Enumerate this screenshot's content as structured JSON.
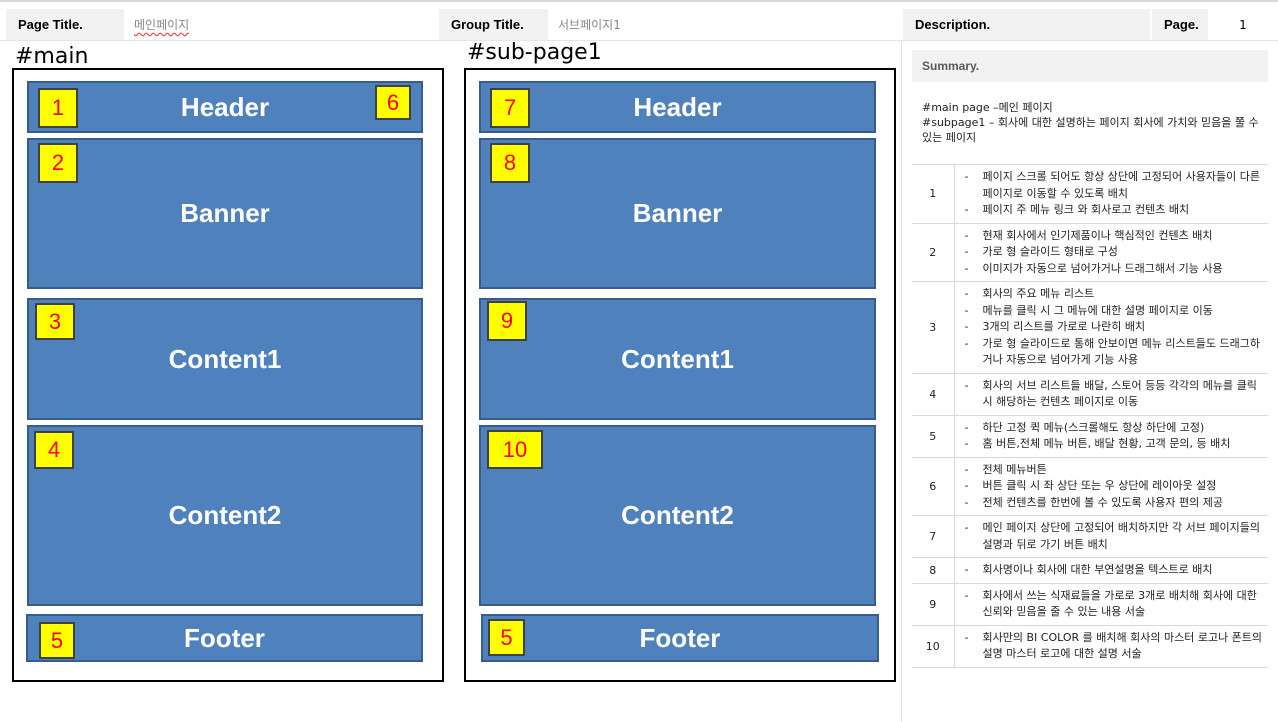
{
  "header": {
    "page_title_label": "Page Title.",
    "page_title_value": "메인페이지",
    "group_title_label": "Group Title.",
    "group_title_value": "서브페이지1",
    "description_label": "Description.",
    "page_label": "Page.",
    "page_value": "1"
  },
  "main_frame": {
    "title": "#main",
    "blocks": {
      "header": "Header",
      "banner": "Banner",
      "content1": "Content1",
      "content2": "Content2",
      "footer": "Footer"
    },
    "badges": [
      "1",
      "6",
      "2",
      "3",
      "4",
      "5"
    ]
  },
  "sub_frame": {
    "title": "#sub-page1",
    "blocks": {
      "header": "Header",
      "banner": "Banner",
      "content1": "Content1",
      "content2": "Content2",
      "footer": "Footer"
    },
    "badges": [
      "7",
      "8",
      "9",
      "10",
      "5"
    ]
  },
  "description": {
    "summary_label": "Summary.",
    "summary_lines": [
      "#main page –메인 페이지",
      "#subpage1 – 회사에 대한 설명하는 페이지 회사에 가치와 믿음을 쭐 수 있는 페이지"
    ],
    "rows": [
      {
        "num": "1",
        "items": [
          "페이지 스크롤 되어도 항상 상단에 고정되어 사용자들이 다른 페이지로 이동할 수 있도록 배치",
          "페이지 주 메뉴 링크 와 회사로고 컨텐츠 배치"
        ]
      },
      {
        "num": "2",
        "items": [
          "현재 회사에서 인기제품이나 핵심적인 컨텐츠 배치",
          "가로 형 슬라이드 형태로 구성",
          "이미지가 자동으로 넘어가거나 드래그해서 기능 사용"
        ]
      },
      {
        "num": "3",
        "items": [
          "회사의 주요 메뉴 리스트",
          "메뉴를 클릭 시 그 메뉴에 대한 설명 페이지로 이동",
          "3개의 리스트를 가로로 나란히 배치",
          "가로 형 슬라이드로 통해 안보이면 메뉴 리스트들도 드래그하거나 자동으로 넘어가게 기능 사용"
        ]
      },
      {
        "num": "4",
        "items": [
          "회사의 서브 리스트들 배달, 스토어 등등 각각의 메뉴를 클릭 시 해당하는 컨텐츠 페이지로 이동"
        ]
      },
      {
        "num": "5",
        "items": [
          "하단 고정 퀵 메뉴(스크롤해도 항상 하단에 고정)",
          "홈 버튼,전체 메뉴 버튼, 배달 현황, 고객 문의, 등 배치"
        ]
      },
      {
        "num": "6",
        "items": [
          "전체 메뉴버튼",
          "버튼 클릭 시 좌 상단 또는 우 상단에 레이아웃 설정",
          "전체 컨텐츠를 한번에 볼 수 있도록 사용자 편의 제공"
        ]
      },
      {
        "num": "7",
        "items": [
          "메인 페이지 상단에 고정되어 배치하지만 각 서브 페이지들의 설명과 뒤로 가기 버튼 배치"
        ]
      },
      {
        "num": "8",
        "items": [
          "회사명이나 회사에 대한 부연설명을 텍스트로 배치"
        ]
      },
      {
        "num": "9",
        "items": [
          "회사에서 쓰는 식재료들을 가로로 3개로 배치해 회사에 대한 신뢰와 믿음을 줄 수 있는 내용 서술"
        ]
      },
      {
        "num": "10",
        "items": [
          "회사만의 BI COLOR 를 배치해 회사의 마스터 로고나 폰트의 설명 마스터 로고에 대한 설명 서술"
        ]
      }
    ]
  },
  "colors": {
    "block_fill": "#4f81bd",
    "block_border": "#385d8a",
    "badge_fill": "#ffff00",
    "badge_text": "#ff0000"
  }
}
